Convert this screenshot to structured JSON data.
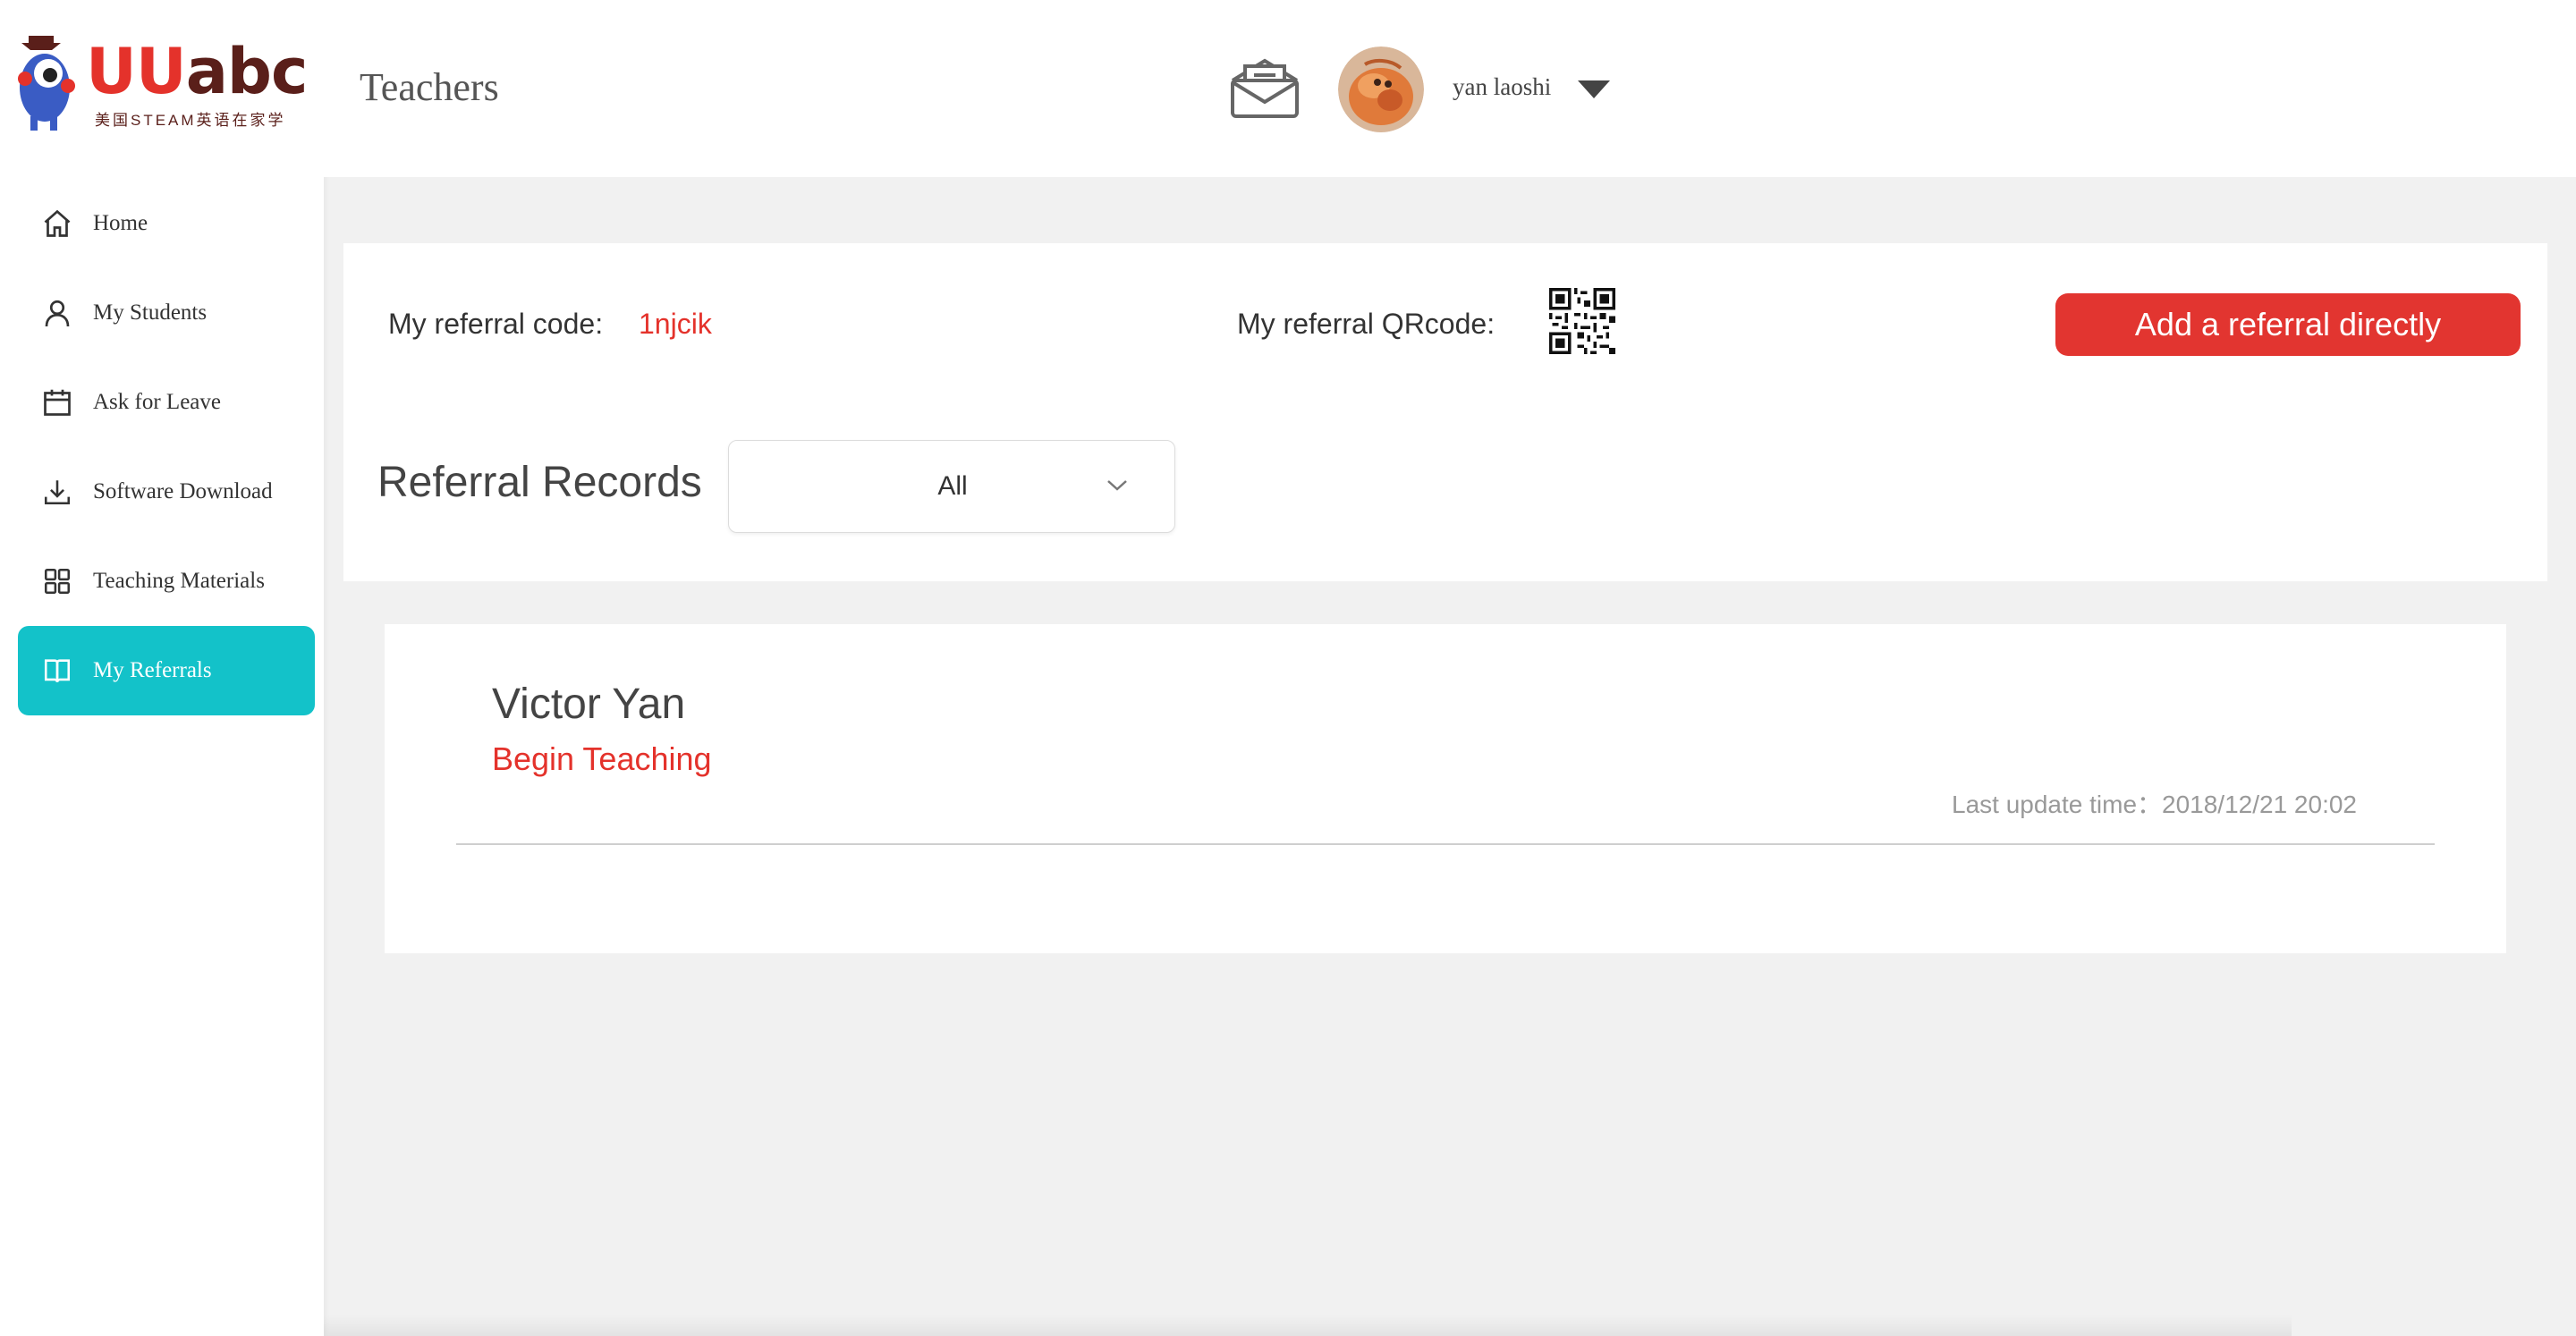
{
  "brand": {
    "logo_text_u": "UU",
    "logo_text_abc": "abc",
    "tagline": "美国STEAM英语在家学",
    "colors": {
      "red": "#e4322b",
      "brown": "#5a1f1a",
      "teal": "#13c2c9"
    }
  },
  "sidebar": {
    "items": [
      {
        "label": "Home",
        "icon": "home-icon",
        "active": false
      },
      {
        "label": "My Students",
        "icon": "user-icon",
        "active": false
      },
      {
        "label": "Ask for Leave",
        "icon": "calendar-icon",
        "active": false
      },
      {
        "label": "Software Download",
        "icon": "download-icon",
        "active": false
      },
      {
        "label": "Teaching Materials",
        "icon": "grid-icon",
        "active": false
      },
      {
        "label": "My Referrals",
        "icon": "book-icon",
        "active": true
      }
    ]
  },
  "header": {
    "title": "Teachers",
    "mail_icon": "mail-icon",
    "username": "yan laoshi"
  },
  "referral": {
    "code_label": "My referral code:",
    "code_value": "1njcik",
    "qr_label": "My referral QRcode:",
    "add_button": "Add a referral directly",
    "records_title": "Referral Records",
    "filter_value": "All"
  },
  "records": [
    {
      "name": "Victor Yan",
      "status": "Begin Teaching",
      "update_text": "Last update time：2018/12/21 20:02"
    }
  ]
}
